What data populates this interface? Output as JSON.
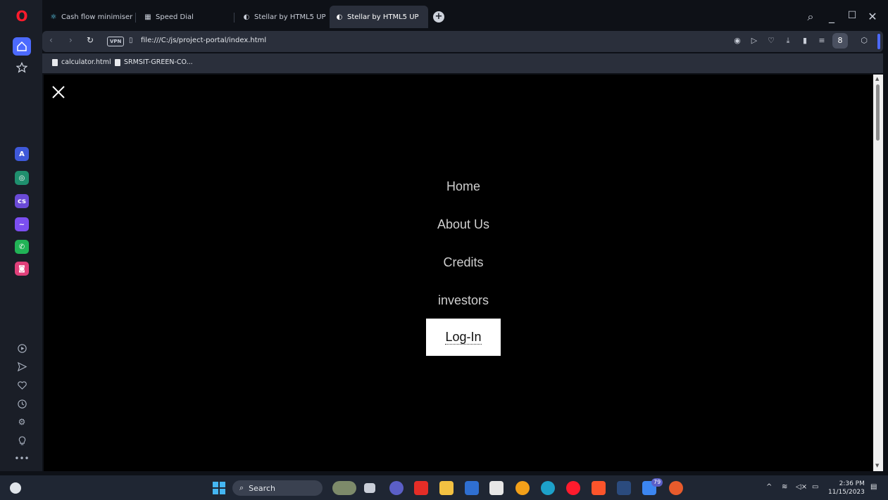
{
  "tabs": [
    {
      "label": "Cash flow minimiser",
      "icon": "react-icon"
    },
    {
      "label": "Speed Dial",
      "icon": "grid-icon"
    },
    {
      "label": "Stellar by HTML5 UP",
      "icon": "globe-icon"
    },
    {
      "label": "Stellar by HTML5 UP",
      "icon": "globe-icon",
      "active": true
    }
  ],
  "address_bar": {
    "vpn_label": "VPN",
    "url": "file:///C:/js/project-portal/index.html"
  },
  "bookmarks": [
    {
      "label": "calculator.html"
    },
    {
      "label": "SRMSIT-GREEN-CO..."
    }
  ],
  "page": {
    "menu": [
      "Home",
      "About Us",
      "Credits",
      "investors"
    ],
    "login_label": "Log-In"
  },
  "taskbar": {
    "search_label": "Search",
    "badge_count": "79",
    "time": "2:36 PM",
    "date": "11/15/2023"
  },
  "colors": {
    "accent": "#4c6aff",
    "opera_red": "#ff1b2d",
    "page_bg": "#000000",
    "menu_text": "#cfcfcf"
  }
}
